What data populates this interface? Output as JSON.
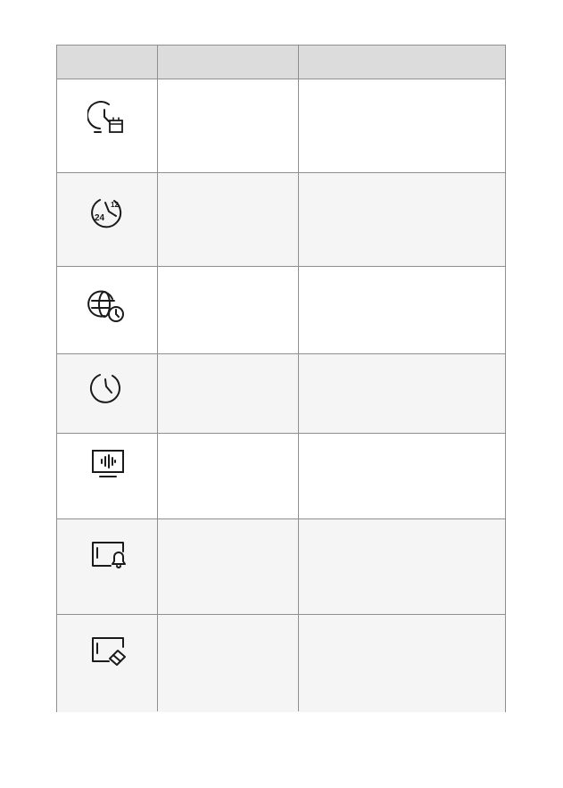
{
  "table": {
    "headers": [
      "",
      "",
      ""
    ],
    "rows": [
      {
        "icon": "clock-calendar-icon",
        "name": "",
        "description": ""
      },
      {
        "icon": "clock-24-12-icon",
        "name": "",
        "description": ""
      },
      {
        "icon": "globe-clock-icon",
        "name": "",
        "description": ""
      },
      {
        "icon": "clock-icon",
        "name": "",
        "description": ""
      },
      {
        "icon": "monitor-audio-wave-icon",
        "name": "",
        "description": ""
      },
      {
        "icon": "card-bell-icon",
        "name": "",
        "description": ""
      },
      {
        "icon": "card-eraser-icon",
        "name": "",
        "description": ""
      }
    ]
  },
  "colors": {
    "header_bg": "#dcdcdc",
    "row_shade": "#f5f5f5",
    "border": "#8f8f8f",
    "icon_stroke": "#1a1a1a"
  }
}
